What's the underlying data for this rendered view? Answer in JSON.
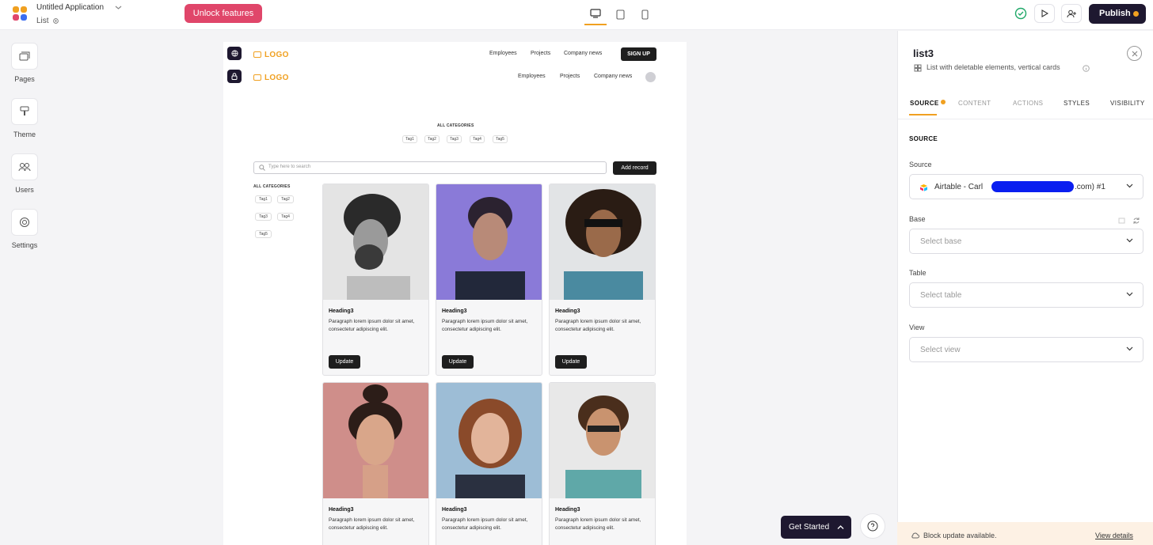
{
  "app": {
    "title": "Untitled Application",
    "page": "List"
  },
  "topbar": {
    "unlock_label": "Unlock features",
    "publish_label": "Publish"
  },
  "leftnav": {
    "items": [
      {
        "label": "Pages"
      },
      {
        "label": "Theme"
      },
      {
        "label": "Users"
      },
      {
        "label": "Settings"
      }
    ]
  },
  "canvas": {
    "logo": "LOGO",
    "nav1": {
      "employees": "Employees",
      "projects": "Projects",
      "news": "Company news",
      "signup": "SIGN UP"
    },
    "nav2": {
      "employees": "Employees",
      "projects": "Projects",
      "news": "Company news"
    },
    "categories_title": "ALL CATEGORIES",
    "tags": [
      "Tag1",
      "Tag2",
      "Tag3",
      "Tag4",
      "Tag5"
    ],
    "search_placeholder": "Type here to search",
    "add_record": "Add record",
    "sidebar_categories_title": "ALL CATEGORIES",
    "sidebar_tags": [
      "Tag1",
      "Tag2",
      "Tag3",
      "Tag4",
      "Tag5"
    ],
    "cards": [
      {
        "heading": "Heading3",
        "text": "Paragraph lorem ipsum dolor sit amet, consectetur adipiscing elit.",
        "button": "Update"
      },
      {
        "heading": "Heading3",
        "text": "Paragraph lorem ipsum dolor sit amet, consectetur adipiscing elit.",
        "button": "Update"
      },
      {
        "heading": "Heading3",
        "text": "Paragraph lorem ipsum dolor sit amet, consectetur adipiscing elit.",
        "button": "Update"
      },
      {
        "heading": "Heading3",
        "text": "Paragraph lorem ipsum dolor sit amet, consectetur adipiscing elit."
      },
      {
        "heading": "Heading3",
        "text": "Paragraph lorem ipsum dolor sit amet, consectetur adipiscing elit."
      },
      {
        "heading": "Heading3",
        "text": "Paragraph lorem ipsum dolor sit amet, consectetur adipiscing elit."
      }
    ]
  },
  "panel": {
    "title": "list3",
    "subtitle": "List with deletable elements, vertical cards",
    "tabs": [
      "SOURCE",
      "CONTENT",
      "ACTIONS",
      "STYLES",
      "VISIBILITY"
    ],
    "section_title": "SOURCE",
    "source_label": "Source",
    "source_prefix": "Airtable - Carl",
    "source_suffix": ".com) #1",
    "base_label": "Base",
    "base_placeholder": "Select base",
    "table_label": "Table",
    "table_placeholder": "Select table",
    "view_label": "View",
    "view_placeholder": "Select view"
  },
  "banner": {
    "text": "Block update available.",
    "link": "View details"
  },
  "get_started": "Get Started",
  "colors": {
    "accent": "#f0a020",
    "primary_dark": "#1e1830",
    "unlock": "#e0466a"
  }
}
